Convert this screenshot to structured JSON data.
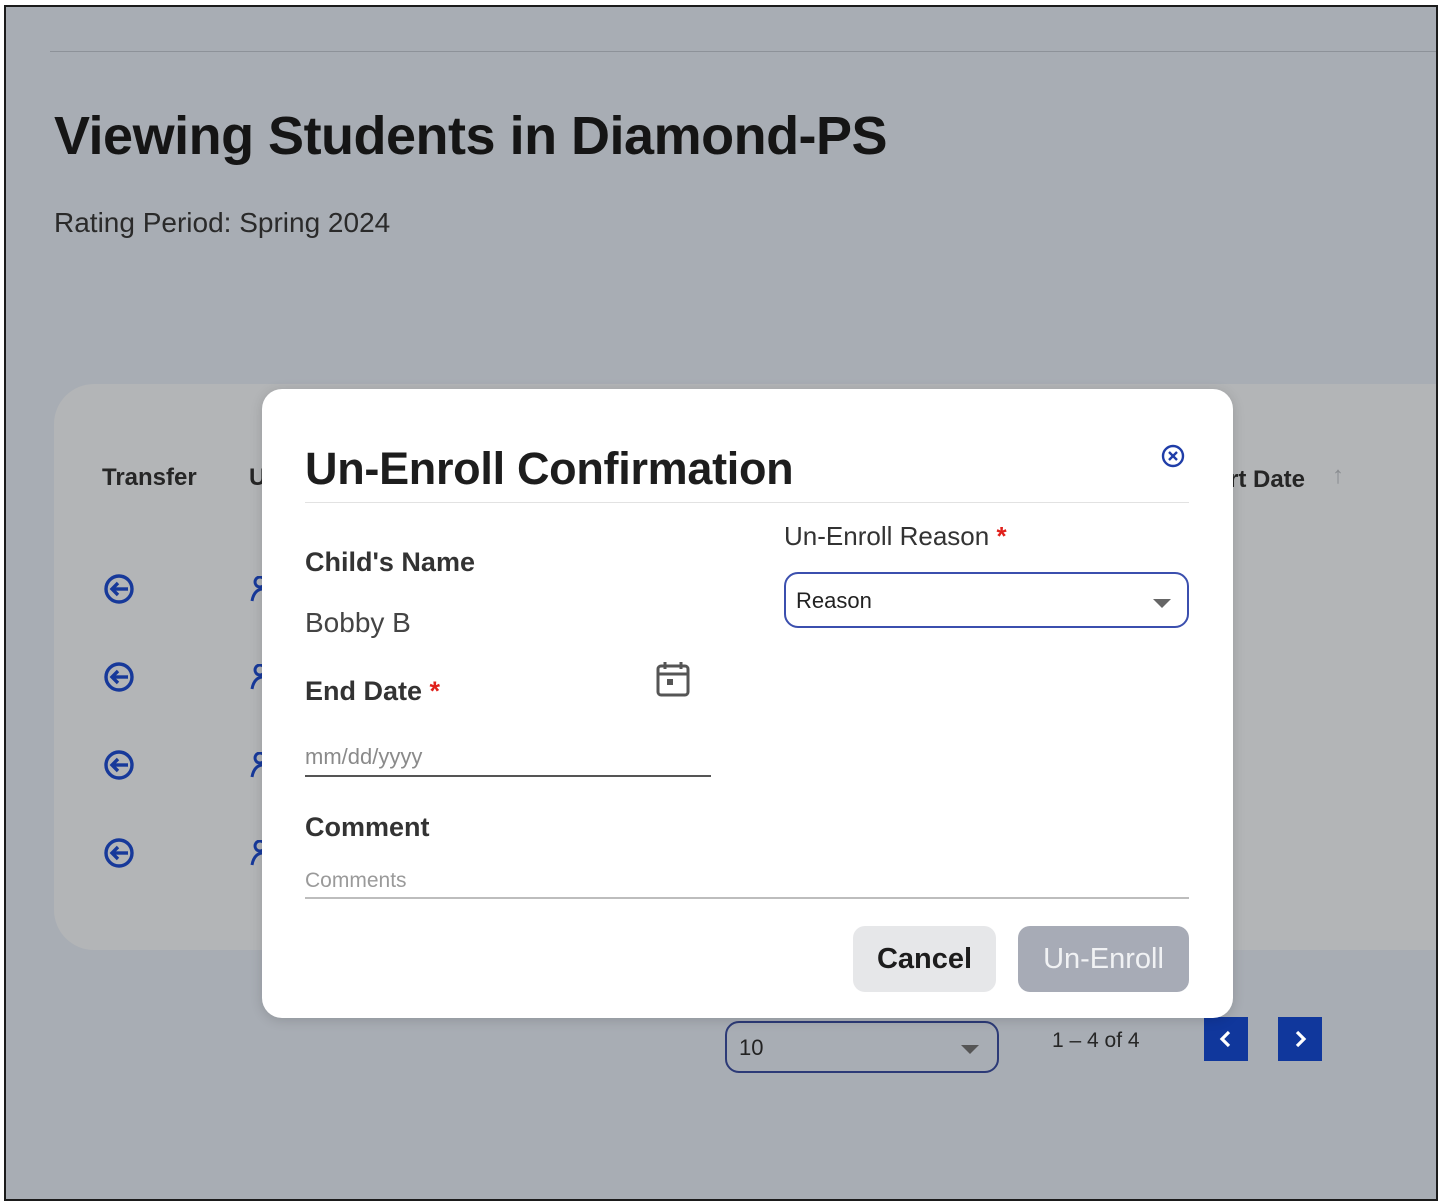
{
  "page": {
    "title": "Viewing Students in Diamond-PS",
    "rating_period": "Rating Period: Spring 2024"
  },
  "table": {
    "headers": {
      "transfer": "Transfer",
      "second_partial": "U",
      "start_date_partial": "rt Date"
    },
    "row_count_visible": 4,
    "row_icon": "transfer-arrow-icon",
    "sort_icon": "arrow-up-icon"
  },
  "pagination": {
    "page_size": "10",
    "range": "1 – 4 of 4",
    "prev_icon": "chevron-left-icon",
    "next_icon": "chevron-right-icon"
  },
  "modal": {
    "title": "Un-Enroll Confirmation",
    "close_icon": "close-circle-icon",
    "child_name_label": "Child's Name",
    "child_name_value": "Bobby B",
    "end_date_label": "End Date",
    "end_date_placeholder": "mm/dd/yyyy",
    "calendar_icon": "calendar-icon",
    "required_marker": "*",
    "reason_label": "Un-Enroll Reason",
    "reason_value": "Reason",
    "comment_label": "Comment",
    "comment_placeholder": "Comments",
    "cancel_label": "Cancel",
    "unenroll_label": "Un-Enroll"
  },
  "colors": {
    "overlay_bg": "#a8adb4",
    "accent_blue": "#10379c",
    "required_red": "#e0201b",
    "disabled_button": "#a7abb6"
  }
}
